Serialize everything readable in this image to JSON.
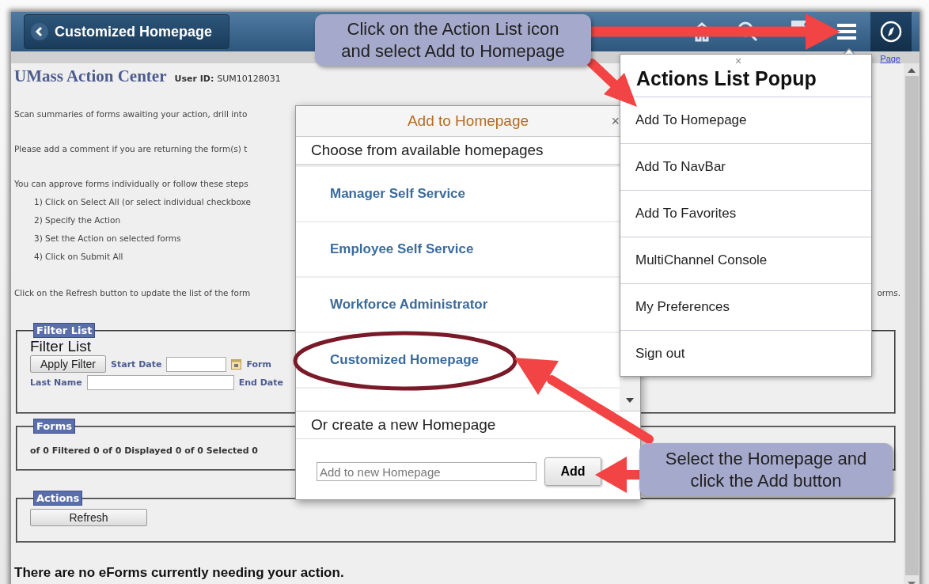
{
  "header": {
    "back_button": "Customized Homepage"
  },
  "page": {
    "title": "UMass Action Center",
    "user_id_label": "User ID:",
    "user_id": "SUM10128031",
    "link": "Page",
    "intro": [
      "Scan summaries of forms awaiting your action, drill into",
      "Please add a comment if you are returning the form(s) t",
      "You can approve forms individually or follow these steps"
    ],
    "steps": [
      "1) Click on Select All (or select individual checkboxe",
      "2) Specify the Action",
      "3) Set the Action on selected forms",
      "4) Click on Submit All"
    ],
    "refresh_note": "Click on the Refresh button to update the list of the form",
    "refresh_note_end": "orms."
  },
  "filter_list": {
    "legend": "Filter List",
    "heading": "Filter List",
    "apply_button": "Apply Filter",
    "start_date_label": "Start Date",
    "form_label": "Form",
    "last_name_label": "Last Name",
    "end_date_label": "End Date"
  },
  "forms": {
    "legend": "Forms",
    "summary": "of 0 Filtered 0 of 0 Displayed 0 of 0 Selected 0"
  },
  "actions": {
    "legend": "Actions",
    "refresh_button": "Refresh"
  },
  "footer_message": "There are no eForms currently needing your action.",
  "add_dialog": {
    "title": "Add to Homepage",
    "close": "×",
    "choose_heading": "Choose from available homepages",
    "homepages": [
      {
        "label": "Manager Self Service",
        "circled": false
      },
      {
        "label": "Employee Self Service",
        "circled": false
      },
      {
        "label": "Workforce Administrator",
        "circled": false
      },
      {
        "label": "Customized Homepage",
        "circled": true
      }
    ],
    "create_heading": "Or create a new Homepage",
    "new_placeholder": "Add to new Homepage",
    "add_button": "Add"
  },
  "actions_popup": {
    "title": "Actions List Popup",
    "close": "×",
    "items": [
      "Add To Homepage",
      "Add To NavBar",
      "Add To Favorites",
      "MultiChannel Console",
      "My Preferences",
      "Sign out"
    ]
  },
  "callouts": [
    {
      "text": "Click on the Action List icon\nand select Add to Homepage"
    },
    {
      "text": "Select the Homepage and\nclick the Add button"
    }
  ]
}
